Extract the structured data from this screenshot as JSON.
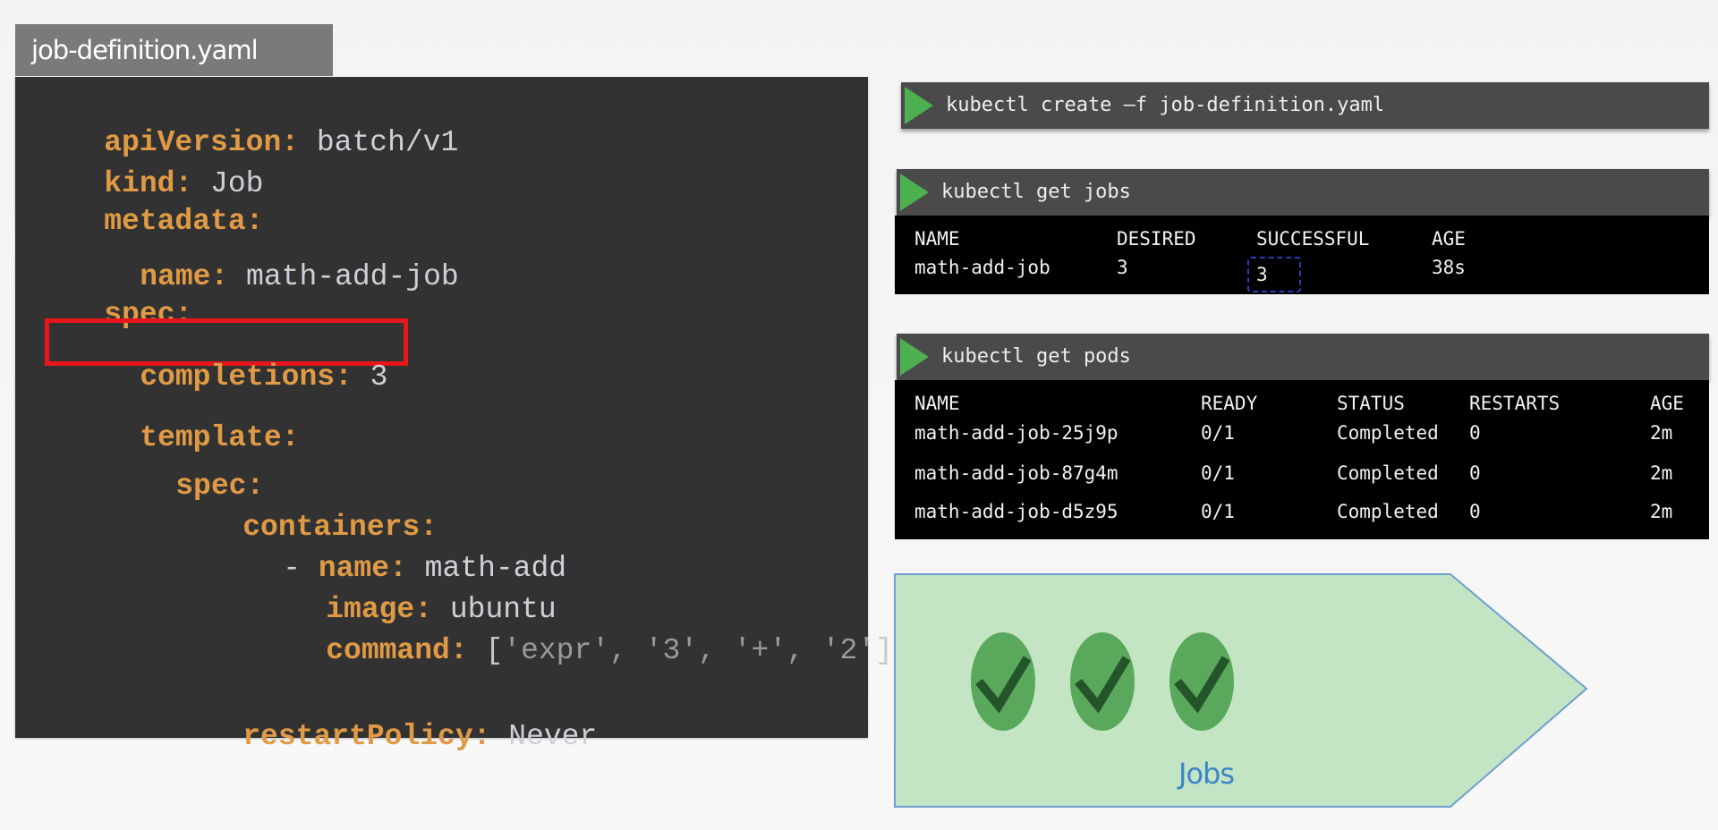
{
  "file": {
    "tab_title": "job-definition.yaml",
    "lines": [
      {
        "key": "apiVersion:",
        "value": " batch/v1"
      },
      {
        "key": "kind:",
        "value": " Job"
      },
      {
        "key": "metadata:",
        "value": ""
      },
      {
        "key": "name:",
        "value": " math-add-job"
      },
      {
        "key": "spec:",
        "value": ""
      },
      {
        "key": "completions:",
        "value": " 3"
      },
      {
        "key": "template:",
        "value": ""
      },
      {
        "key": "spec:",
        "value": ""
      },
      {
        "key": "containers:",
        "value": ""
      },
      {
        "prefix": "- ",
        "key": "name:",
        "value": " math-add"
      },
      {
        "key": "image:",
        "value": " ubuntu"
      },
      {
        "key": "command:",
        "value_open": " [",
        "value_items": "'expr', '3', '+', '2'",
        "value_close": "]"
      },
      {
        "key": "restartPolicy:",
        "value": " Never"
      }
    ],
    "highlighted_line": "completions: 3"
  },
  "terminals": {
    "create": {
      "command": "kubectl create –f job-definition.yaml"
    },
    "get_jobs": {
      "command": "kubectl get jobs",
      "headers": [
        "NAME",
        "DESIRED",
        "SUCCESSFUL",
        "AGE"
      ],
      "rows": [
        [
          "math-add-job",
          "3",
          "3",
          "38s"
        ]
      ]
    },
    "get_pods": {
      "command": "kubectl get pods",
      "headers": [
        "NAME",
        "READY",
        "STATUS",
        "RESTARTS",
        "AGE"
      ],
      "rows": [
        [
          "math-add-job-25j9p",
          "0/1",
          "Completed",
          "0",
          "2m"
        ],
        [
          "math-add-job-87g4m",
          "0/1",
          "Completed",
          "0",
          "2m"
        ],
        [
          "math-add-job-d5z95",
          "0/1",
          "Completed",
          "0",
          "2m"
        ]
      ]
    }
  },
  "jobs_diagram": {
    "label": "Jobs",
    "completed_count": 3,
    "icons": [
      "check-circle-icon",
      "check-circle-icon",
      "check-circle-icon"
    ]
  },
  "colors": {
    "yaml_key": "#e09a45",
    "yaml_value": "#cfcfd8",
    "highlight": "#e8161b",
    "prompt_icon": "#4caf50",
    "arrow_fill": "#c3e5c3",
    "arrow_stroke": "#6f9fd0",
    "check_circle": "#5aa85c",
    "check_mark": "#24552a",
    "jobs_label": "#3a86c8"
  }
}
